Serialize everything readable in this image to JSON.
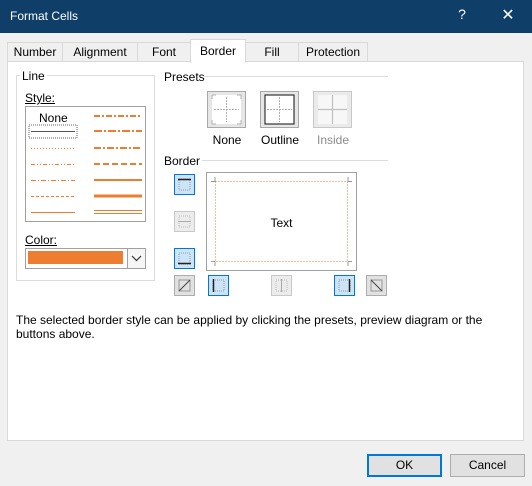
{
  "window": {
    "title": "Format Cells",
    "help_glyph": "?",
    "close_glyph": "✕"
  },
  "tabs": [
    {
      "label": "Number"
    },
    {
      "label": "Alignment"
    },
    {
      "label": "Font"
    },
    {
      "label": "Border",
      "active": true
    },
    {
      "label": "Fill"
    },
    {
      "label": "Protection"
    }
  ],
  "line_group": {
    "title": "Line",
    "style_label": "Style:",
    "style_none": "None",
    "color_label": "Color:",
    "color_value": "#ed7d31"
  },
  "presets": {
    "title": "Presets",
    "items": [
      {
        "label": "None",
        "enabled": true
      },
      {
        "label": "Outline",
        "enabled": true
      },
      {
        "label": "Inside",
        "enabled": false
      }
    ]
  },
  "border": {
    "title": "Border",
    "preview_text": "Text"
  },
  "info": "The selected border style can be applied by clicking the presets, preview diagram or the buttons above.",
  "buttons": {
    "ok": "OK",
    "cancel": "Cancel"
  },
  "colors": {
    "accent": "#0078d7",
    "titlebar": "#0f3e69",
    "line_color": "#ed7d31"
  }
}
